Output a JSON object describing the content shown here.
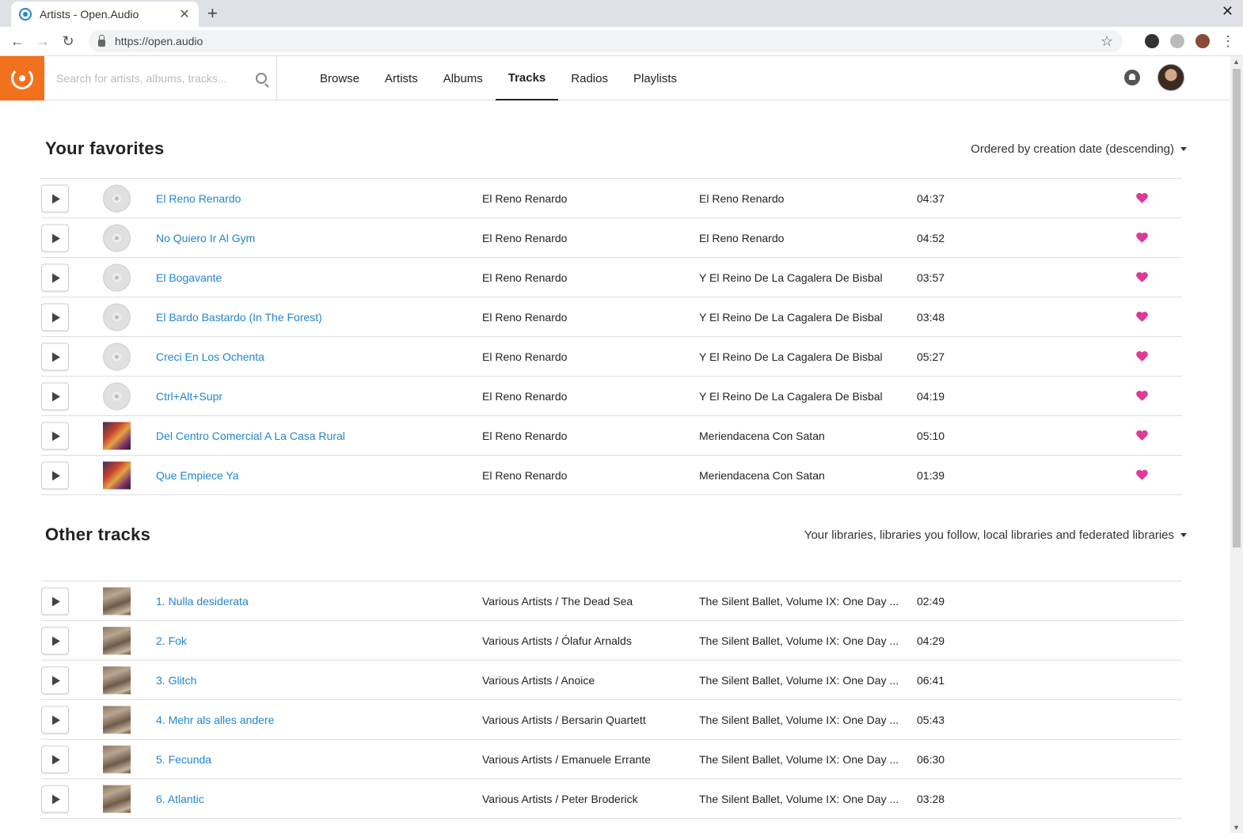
{
  "browser": {
    "tab_title": "Artists - Open.Audio",
    "tab_close": "✕",
    "new_tab": "+",
    "window_close": "✕",
    "url": "https://open.audio",
    "back": "←",
    "forward": "→",
    "reload": "↻",
    "star": "☆",
    "menu": "⋮"
  },
  "header": {
    "search_placeholder": "Search for artists, albums, tracks...",
    "menu": [
      "Browse",
      "Artists",
      "Albums",
      "Tracks",
      "Radios",
      "Playlists"
    ],
    "active_menu": "Tracks"
  },
  "favorites": {
    "title": "Your favorites",
    "order_label": "Ordered by creation date (descending)",
    "rows": [
      {
        "title": "El Reno Renardo",
        "artist": "El Reno Renardo",
        "album": "El Reno Renardo",
        "duration": "04:37",
        "cover": "disc"
      },
      {
        "title": "No Quiero Ir Al Gym",
        "artist": "El Reno Renardo",
        "album": "El Reno Renardo",
        "duration": "04:52",
        "cover": "disc"
      },
      {
        "title": "El Bogavante",
        "artist": "El Reno Renardo",
        "album": "Y El Reino De La Cagalera De Bisbal",
        "duration": "03:57",
        "cover": "disc"
      },
      {
        "title": "El Bardo Bastardo (In The Forest)",
        "artist": "El Reno Renardo",
        "album": "Y El Reino De La Cagalera De Bisbal",
        "duration": "03:48",
        "cover": "disc"
      },
      {
        "title": "Creci En Los Ochenta",
        "artist": "El Reno Renardo",
        "album": "Y El Reino De La Cagalera De Bisbal",
        "duration": "05:27",
        "cover": "disc"
      },
      {
        "title": "Ctrl+Alt+Supr",
        "artist": "El Reno Renardo",
        "album": "Y El Reino De La Cagalera De Bisbal",
        "duration": "04:19",
        "cover": "disc"
      },
      {
        "title": "Del Centro Comercial A La Casa Rural",
        "artist": "El Reno Renardo",
        "album": "Meriendacena Con Satan",
        "duration": "05:10",
        "cover": "art-red"
      },
      {
        "title": "Que Empiece Ya",
        "artist": "El Reno Renardo",
        "album": "Meriendacena Con Satan",
        "duration": "01:39",
        "cover": "art-red"
      }
    ]
  },
  "other": {
    "title": "Other tracks",
    "filter_label": "Your libraries, libraries you follow, local libraries and federated libraries",
    "rows": [
      {
        "title": "1. Nulla desiderata",
        "artist": "Various Artists / The Dead Sea",
        "album": "The Silent Ballet, Volume IX: One Day ...",
        "duration": "02:49",
        "cover": "art-brown"
      },
      {
        "title": "2. Fok",
        "artist": "Various Artists / Ólafur Arnalds",
        "album": "The Silent Ballet, Volume IX: One Day ...",
        "duration": "04:29",
        "cover": "art-brown"
      },
      {
        "title": "3. Glitch",
        "artist": "Various Artists / Anoice",
        "album": "The Silent Ballet, Volume IX: One Day ...",
        "duration": "06:41",
        "cover": "art-brown"
      },
      {
        "title": "4. Mehr als alles andere",
        "artist": "Various Artists / Bersarin Quartett",
        "album": "The Silent Ballet, Volume IX: One Day ...",
        "duration": "05:43",
        "cover": "art-brown"
      },
      {
        "title": "5. Fecunda",
        "artist": "Various Artists / Emanuele Errante",
        "album": "The Silent Ballet, Volume IX: One Day ...",
        "duration": "06:30",
        "cover": "art-brown"
      },
      {
        "title": "6. Atlantic",
        "artist": "Various Artists / Peter Broderick",
        "album": "The Silent Ballet, Volume IX: One Day ...",
        "duration": "03:28",
        "cover": "art-brown"
      }
    ]
  },
  "colors": {
    "accent": "#f2711c",
    "link": "#2185d0",
    "heart": "#e03997"
  }
}
